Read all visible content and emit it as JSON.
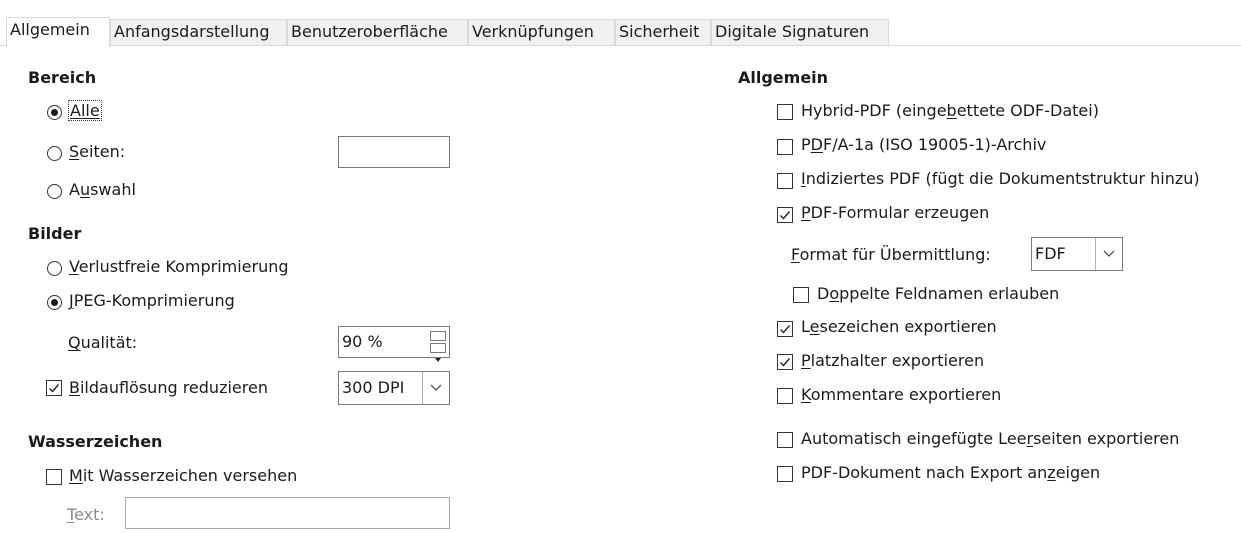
{
  "tabs": [
    {
      "label": "Allgemein",
      "active": true
    },
    {
      "label": "Anfangsdarstellung"
    },
    {
      "label": "Benutzeroberfläche"
    },
    {
      "label": "Verknüpfungen"
    },
    {
      "label": "Sicherheit"
    },
    {
      "label": "Digitale Signaturen"
    }
  ],
  "bereich": {
    "heading": "Bereich",
    "alle": {
      "label": "Alle",
      "selected": true
    },
    "seiten": {
      "pre": "",
      "u": "S",
      "post": "eiten:",
      "value": ""
    },
    "auswahl": {
      "pre": "A",
      "u": "u",
      "post": "swahl",
      "selected": false
    }
  },
  "bilder": {
    "heading": "Bilder",
    "verlustfrei": {
      "pre": "",
      "u": "V",
      "post": "erlustfreie Komprimierung",
      "selected": false
    },
    "jpeg": {
      "pre": "",
      "u": "J",
      "post": "PEG-Komprimierung",
      "selected": true
    },
    "qualitaet": {
      "pre": "",
      "u": "Q",
      "post": "ualität:",
      "value": "90 %"
    },
    "bildaufloesung": {
      "pre": "",
      "u": "B",
      "post": "ildauflösung reduzieren",
      "checked": true,
      "value": "300 DPI"
    }
  },
  "wasserzeichen": {
    "heading": "Wasserzeichen",
    "mit": {
      "pre": "",
      "u": "M",
      "post": "it Wasserzeichen versehen",
      "checked": false
    },
    "text": {
      "pre": "",
      "u": "T",
      "post": "ext:",
      "value": ""
    }
  },
  "allgemein": {
    "heading": "Allgemein",
    "hybrid": {
      "pre": "Hybrid-PDF (einge",
      "u": "b",
      "post": "ettete ODF-Datei)",
      "checked": false
    },
    "pdfa": {
      "pre": "P",
      "u": "D",
      "post": "F/A-1a (ISO 19005-1)-Archiv",
      "checked": false
    },
    "indiziert": {
      "pre": "",
      "u": "I",
      "post": "ndiziertes PDF (fügt die Dokumentstruktur hinzu)",
      "checked": false
    },
    "formular": {
      "pre": "",
      "u": "P",
      "post": "DF-Formular erzeugen",
      "checked": true
    },
    "format": {
      "pre": "",
      "u": "F",
      "post": "ormat für Übermittlung:",
      "value": "FDF"
    },
    "doppelte": {
      "pre": "D",
      "u": "o",
      "post": "ppelte Feldnamen erlauben",
      "checked": false
    },
    "lesezeichen": {
      "pre": "L",
      "u": "e",
      "post": "sezeichen exportieren",
      "checked": true
    },
    "platzhalter": {
      "pre": "",
      "u": "P",
      "post": "latzhalter exportieren",
      "checked": true
    },
    "kommentare": {
      "pre": "",
      "u": "K",
      "post": "ommentare exportieren",
      "checked": false
    },
    "leerseiten": {
      "pre": "Automatisch eingefügte Lee",
      "u": "r",
      "post": "seiten exportieren",
      "checked": false
    },
    "anzeigen": {
      "pre": "PDF-Dokument nach Export an",
      "u": "z",
      "post": "eigen",
      "checked": false
    }
  }
}
